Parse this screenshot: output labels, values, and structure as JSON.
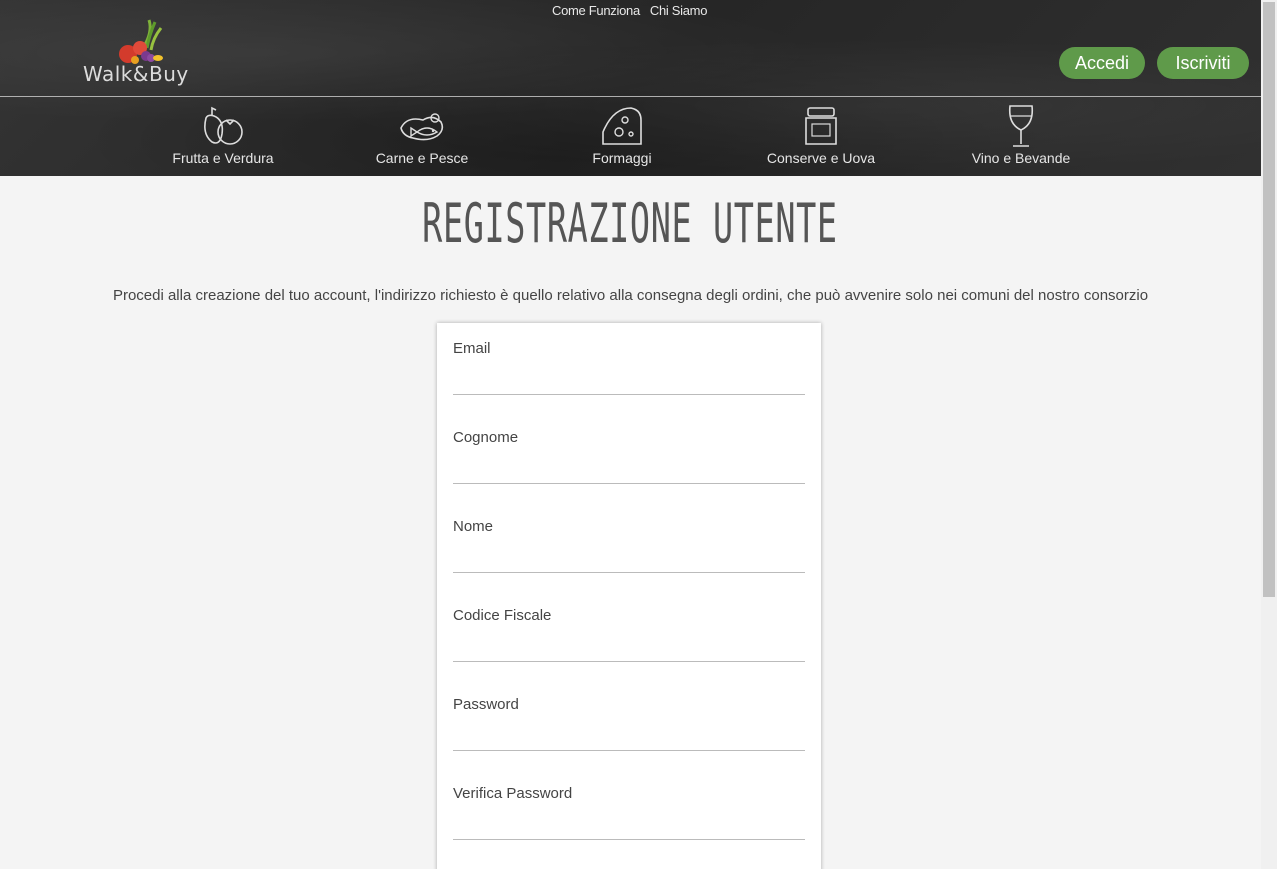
{
  "nav": {
    "top_links": [
      "Come Funziona",
      "Chi Siamo"
    ],
    "logo_text": "Walk&Buy",
    "login_label": "Accedi",
    "signup_label": "Iscriviti"
  },
  "categories": [
    {
      "label": "Frutta e Verdura",
      "icon": "fruit-vegetable-icon"
    },
    {
      "label": "Carne e Pesce",
      "icon": "meat-fish-icon"
    },
    {
      "label": "Formaggi",
      "icon": "cheese-icon"
    },
    {
      "label": "Conserve e Uova",
      "icon": "jar-icon"
    },
    {
      "label": "Vino e Bevande",
      "icon": "wine-glass-icon"
    }
  ],
  "page": {
    "title": "REGISTRAZIONE UTENTE",
    "intro": "Procedi alla creazione del tuo account, l'indirizzo richiesto è quello relativo alla consegna degli ordini, che può avvenire solo nei comuni del nostro consorzio"
  },
  "form": {
    "fields": [
      {
        "label": "Email",
        "value": ""
      },
      {
        "label": "Cognome",
        "value": ""
      },
      {
        "label": "Nome",
        "value": ""
      },
      {
        "label": "Codice Fiscale",
        "value": ""
      },
      {
        "label": "Password",
        "value": ""
      },
      {
        "label": "Verifica Password",
        "value": ""
      }
    ]
  },
  "colors": {
    "accent": "#5f9a4a",
    "header_bg": "#2b2b2b",
    "page_bg": "#f4f4f4"
  }
}
